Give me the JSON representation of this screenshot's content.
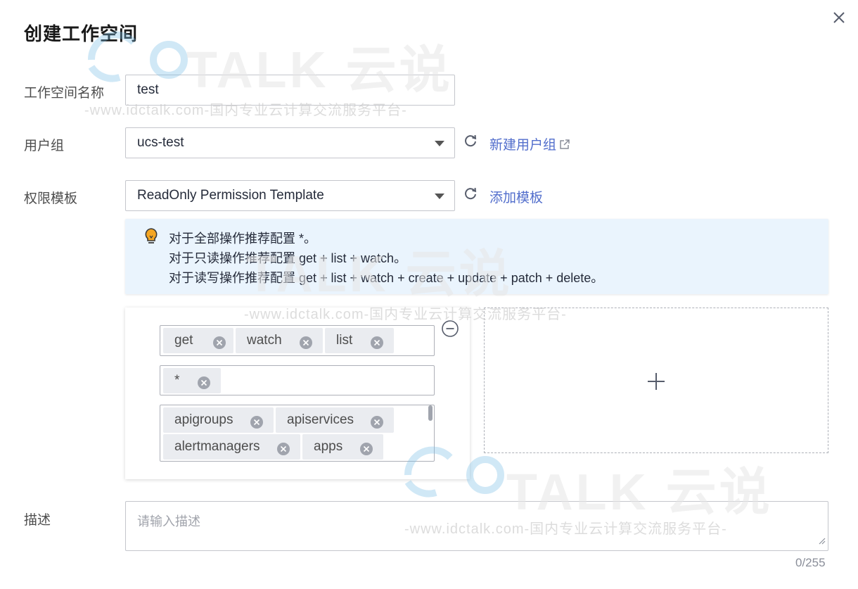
{
  "dialog": {
    "title": "创建工作空间",
    "close_icon": "close-icon"
  },
  "form": {
    "workspace_name": {
      "label": "工作空间名称",
      "value": "test"
    },
    "user_group": {
      "label": "用户组",
      "value": "ucs-test",
      "refresh_icon": "refresh-icon",
      "create_link": "新建用户组",
      "external_icon": "external-link-icon"
    },
    "permission_template": {
      "label": "权限模板",
      "value": "ReadOnly Permission Template",
      "refresh_icon": "refresh-icon",
      "add_link": "添加模板"
    },
    "tip": {
      "icon": "lightbulb-icon",
      "lines": [
        "对于全部操作推荐配置 *。",
        "对于只读操作推荐配置 get + list + watch。",
        "对于读写操作推荐配置 get + list + watch + create + update + patch + delete。"
      ]
    },
    "rule": {
      "verbs": [
        "get",
        "watch",
        "list"
      ],
      "api_groups": [
        "*"
      ],
      "resources": [
        "apigroups",
        "apiservices",
        "alertmanagers",
        "apps"
      ],
      "remove_icon": "minus-circle-icon",
      "add_icon": "plus-icon"
    },
    "description": {
      "label": "描述",
      "placeholder": "请输入描述",
      "counter": "0/255"
    }
  },
  "watermark": {
    "brand": "TALK 云说",
    "text": "-www.idctalk.com-国内专业云计算交流服务平台-"
  },
  "colors": {
    "link": "#526ecc",
    "tip_background": "#eaf4fd",
    "tag_background": "#eaecf0",
    "bulb": "#f5a623"
  }
}
